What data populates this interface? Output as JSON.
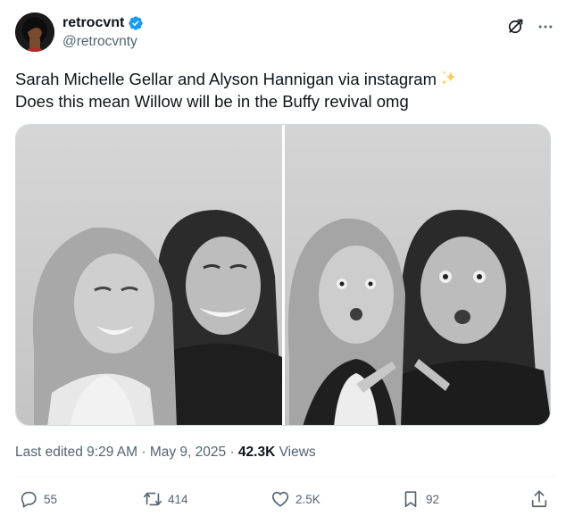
{
  "author": {
    "display_name": "retrocvnt",
    "handle": "@retrocvnty",
    "verified": true
  },
  "tweet": {
    "text_line_1": "Sarah Michelle Gellar and Alyson Hannigan via instagram",
    "text_line_2": "Does this mean Willow will be in the Buffy revival omg"
  },
  "meta": {
    "edited": "Last edited 9:29 AM",
    "separator": "·",
    "date": "May 9, 2025",
    "views_count": "42.3K",
    "views_label": "Views"
  },
  "actions": {
    "replies": "55",
    "reposts": "414",
    "likes": "2.5K",
    "bookmarks": "92"
  },
  "icons": {
    "verified": "verified-badge-icon",
    "grok": "grok-icon",
    "more": "more-icon",
    "sparkle": "sparkles-icon",
    "reply": "reply-icon",
    "repost": "repost-icon",
    "like": "heart-icon",
    "bookmark": "bookmark-icon",
    "share": "share-icon"
  },
  "colors": {
    "text_primary": "#0f1419",
    "text_secondary": "#536471",
    "verified_blue": "#1d9bf0",
    "divider": "#eff3f4",
    "sparkle_yellow": "#fdcb58"
  }
}
